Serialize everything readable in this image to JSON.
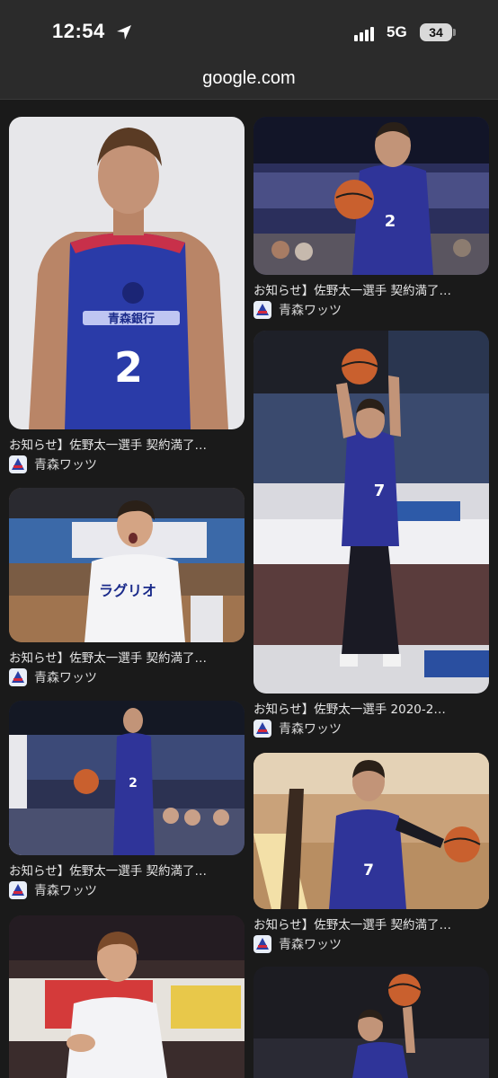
{
  "status_bar": {
    "time": "12:54",
    "network": "5G",
    "battery": "34"
  },
  "browser": {
    "domain": "google.com"
  },
  "results": [
    {
      "caption": "お知らせ】佐野太一選手 契約満了…",
      "source": "青森ワッツ",
      "jersey": "2",
      "sponsor": "青森銀行"
    },
    {
      "caption": "お知らせ】佐野太一選手 契約満了…",
      "source": "青森ワッツ",
      "jersey": "2"
    },
    {
      "caption": "お知らせ】佐野太一選手 契約満了…",
      "source": "青森ワッツ",
      "jersey_text": "ラグリオ"
    },
    {
      "caption": "お知らせ】佐野太一選手 2020-2…",
      "source": "青森ワッツ",
      "jersey": "7"
    },
    {
      "caption": "お知らせ】佐野太一選手 契約満了…",
      "source": "青森ワッツ",
      "jersey": "2"
    },
    {
      "caption": "お知らせ】佐野太一選手 契約満了…",
      "source": "青森ワッツ",
      "jersey": "7"
    },
    {
      "caption": "",
      "source": ""
    },
    {
      "caption": "",
      "source": ""
    }
  ]
}
